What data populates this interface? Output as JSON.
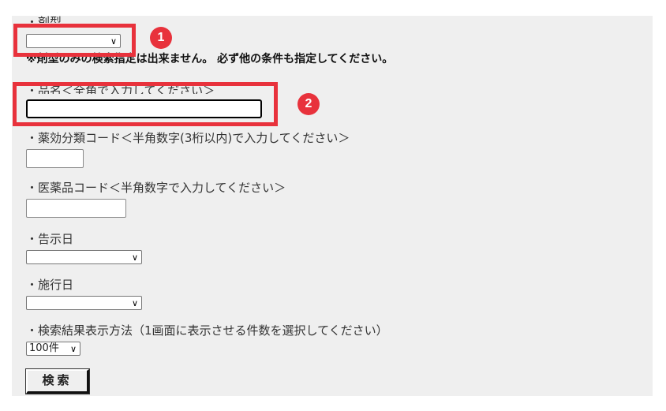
{
  "form": {
    "dosage_form_label": "・剤型",
    "dosage_form_value": "",
    "dosage_form_note": "※剤型のみの検索指定は出来ません。 必ず他の条件も指定してください。",
    "product_name_label": "・品名＜全角で入力してください＞",
    "product_name_value": "",
    "efficacy_code_label": "・薬効分類コード＜半角数字(3桁以内)で入力してください＞",
    "efficacy_code_value": "",
    "drug_code_label": "・医薬品コード＜半角数字で入力してください＞",
    "drug_code_value": "",
    "notice_date_label": "・告示日",
    "notice_date_value": "",
    "effective_date_label": "・施行日",
    "effective_date_value": "",
    "display_method_label": "・検索結果表示方法（1画面に表示させる件数を選択してください）",
    "display_count_value": "100件",
    "search_button_label": "検索"
  },
  "annotations": {
    "badge_1": "1",
    "badge_2": "2",
    "highlight_color": "#e8323c"
  }
}
